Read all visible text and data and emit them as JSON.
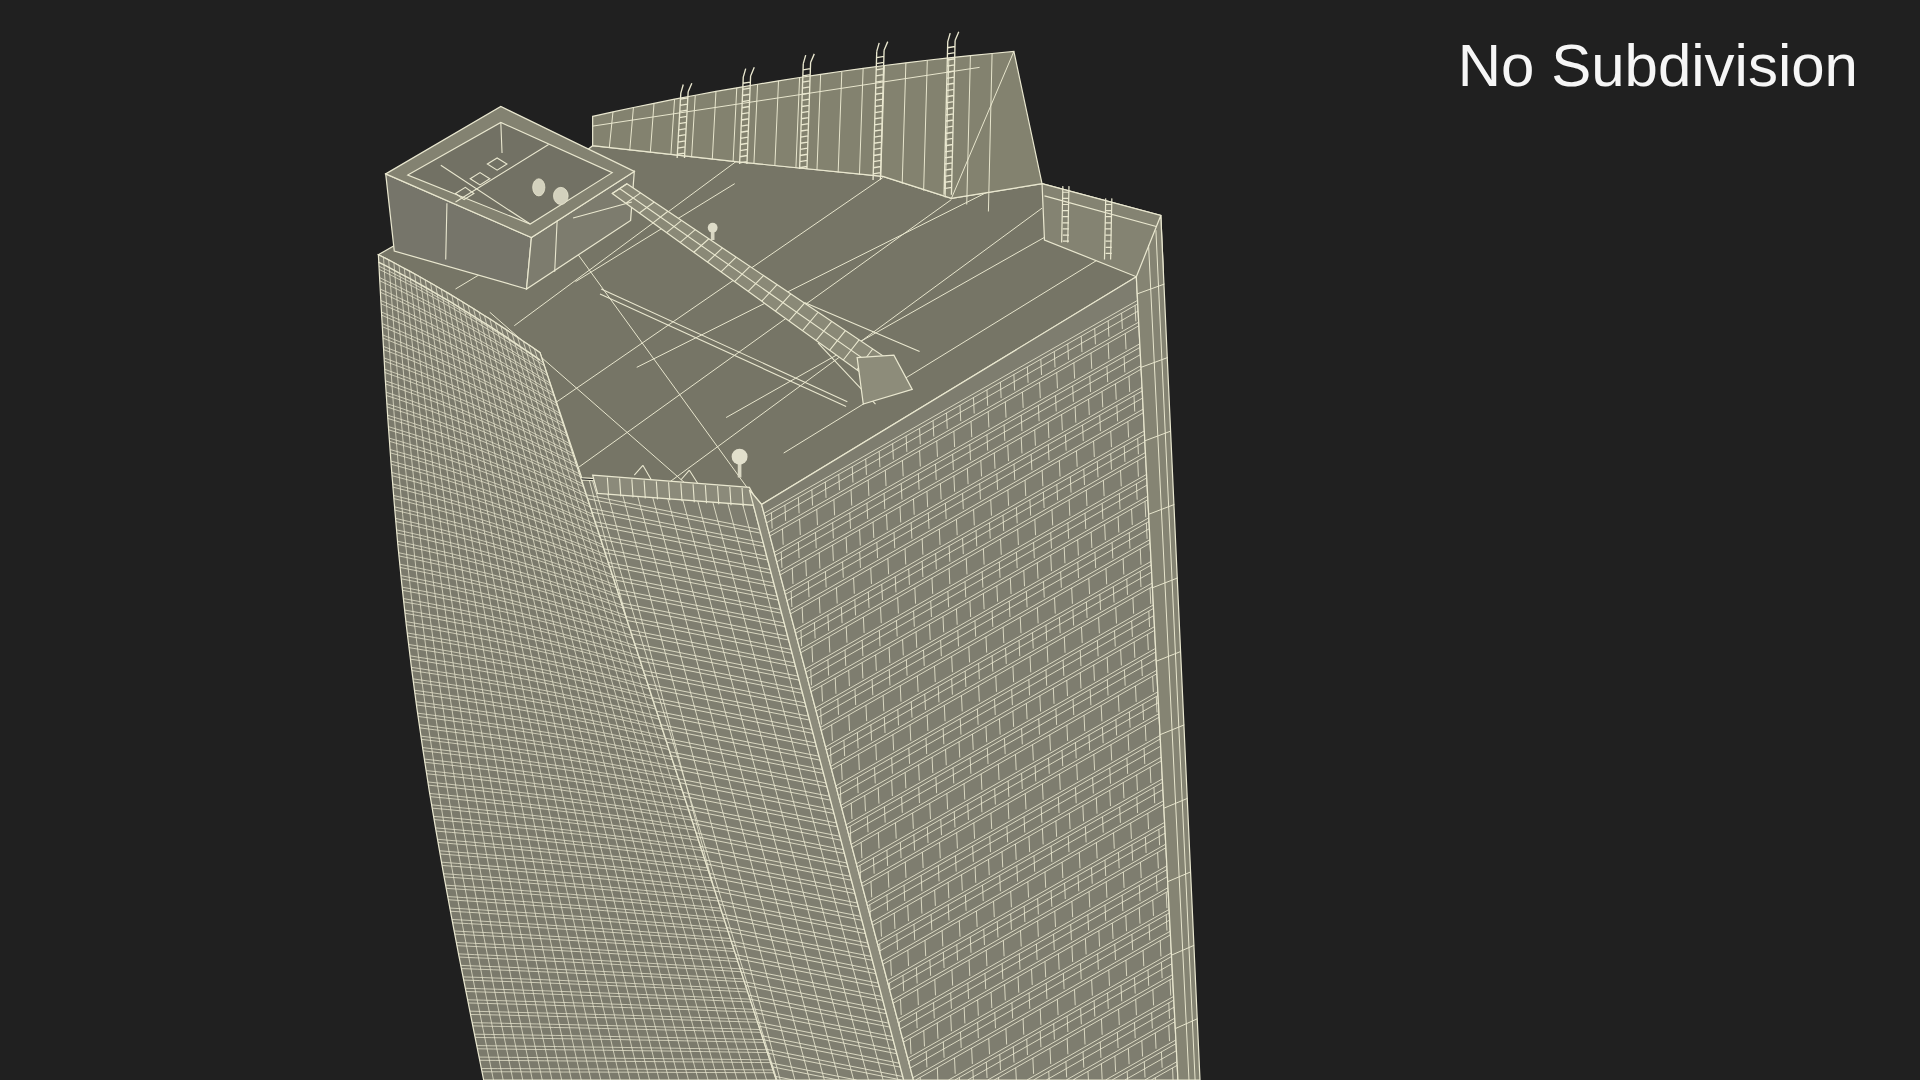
{
  "viewport": {
    "label": "No Subdivision"
  }
}
